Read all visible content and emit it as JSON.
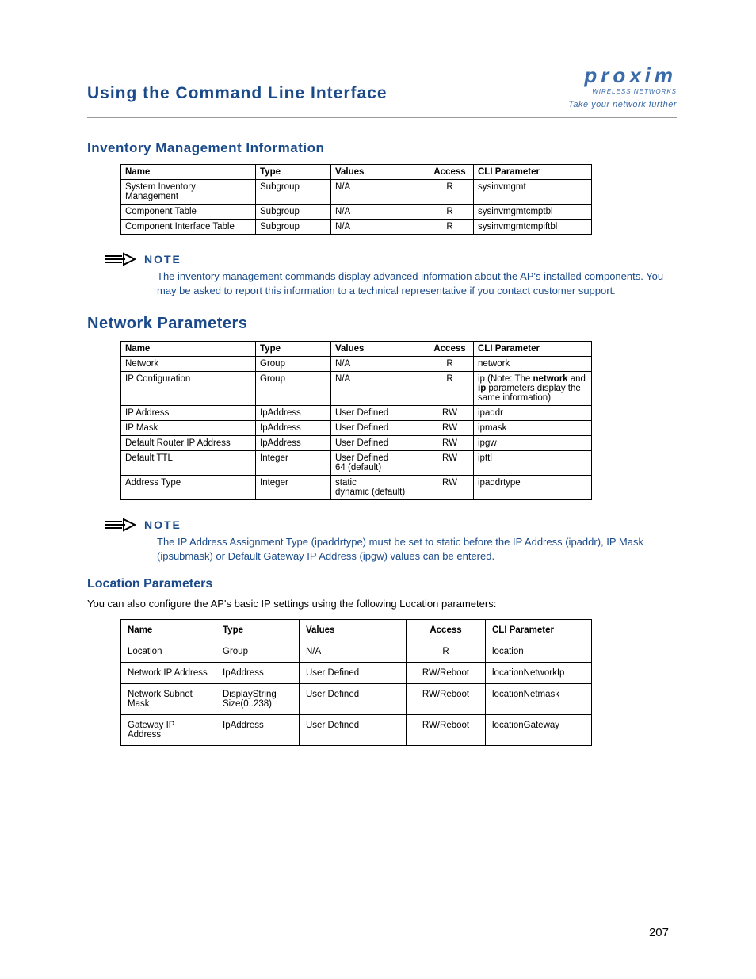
{
  "header": {
    "title": "Using the Command Line Interface",
    "logo_main": "proxim",
    "logo_sub": "WIRELESS NETWORKS",
    "logo_tag": "Take your network further"
  },
  "inventory": {
    "heading": "Inventory Management Information",
    "columns": [
      "Name",
      "Type",
      "Values",
      "Access",
      "CLI Parameter"
    ],
    "rows": [
      {
        "name": "System Inventory Management",
        "type": "Subgroup",
        "values": "N/A",
        "access": "R",
        "cli": "sysinvmgmt"
      },
      {
        "name": "Component Table",
        "type": "Subgroup",
        "values": "N/A",
        "access": "R",
        "cli": "sysinvmgmtcmptbl"
      },
      {
        "name": "Component Interface Table",
        "type": "Subgroup",
        "values": "N/A",
        "access": "R",
        "cli": "sysinvmgmtcmpiftbl"
      }
    ],
    "note_label": "NOTE",
    "note_text": "The inventory management commands display advanced information about the AP's installed components. You may be asked to report this information to a technical representative if you contact customer support."
  },
  "network": {
    "heading": "Network Parameters",
    "columns": [
      "Name",
      "Type",
      "Values",
      "Access",
      "CLI Parameter"
    ],
    "rows": [
      {
        "name": "Network",
        "type": "Group",
        "values": "N/A",
        "access": "R",
        "cli": "network"
      },
      {
        "name": "IP Configuration",
        "type": "Group",
        "values": "N/A",
        "access": "R",
        "cli_html": "ip (Note: The <b>network</b> and <b>ip</b> parameters display the same information)"
      },
      {
        "name": "IP Address",
        "type": "IpAddress",
        "values": "User Defined",
        "access": "RW",
        "cli": "ipaddr"
      },
      {
        "name": "IP Mask",
        "type": "IpAddress",
        "values": "User Defined",
        "access": "RW",
        "cli": "ipmask"
      },
      {
        "name": "Default Router IP Address",
        "type": "IpAddress",
        "values": "User Defined",
        "access": "RW",
        "cli": "ipgw"
      },
      {
        "name": "Default TTL",
        "type": "Integer",
        "values": "User Defined\n64 (default)",
        "access": "RW",
        "cli": "ipttl"
      },
      {
        "name": "Address Type",
        "type": "Integer",
        "values": "static\ndynamic (default)",
        "access": "RW",
        "cli": "ipaddrtype"
      }
    ],
    "note_label": "NOTE",
    "note_text": "The IP Address Assignment Type (ipaddrtype) must be set to static before the IP Address (ipaddr), IP Mask (ipsubmask) or Default Gateway IP Address (ipgw) values can be entered."
  },
  "location": {
    "heading": "Location Parameters",
    "intro": "You can also configure the AP's basic IP settings using the following Location parameters:",
    "columns": [
      "Name",
      "Type",
      "Values",
      "Access",
      "CLI Parameter"
    ],
    "rows": [
      {
        "name": "Location",
        "type": "Group",
        "values": "N/A",
        "access": "R",
        "cli": "location"
      },
      {
        "name": "Network IP Address",
        "type": "IpAddress",
        "values": "User Defined",
        "access": "RW/Reboot",
        "cli": "locationNetworkIp"
      },
      {
        "name": "Network Subnet Mask",
        "type": "DisplayString\nSize(0..238)",
        "values": "User Defined",
        "access": "RW/Reboot",
        "cli": "locationNetmask"
      },
      {
        "name": "Gateway IP Address",
        "type": "IpAddress",
        "values": "User Defined",
        "access": "RW/Reboot",
        "cli": "locationGateway"
      }
    ]
  },
  "page_number": "207"
}
